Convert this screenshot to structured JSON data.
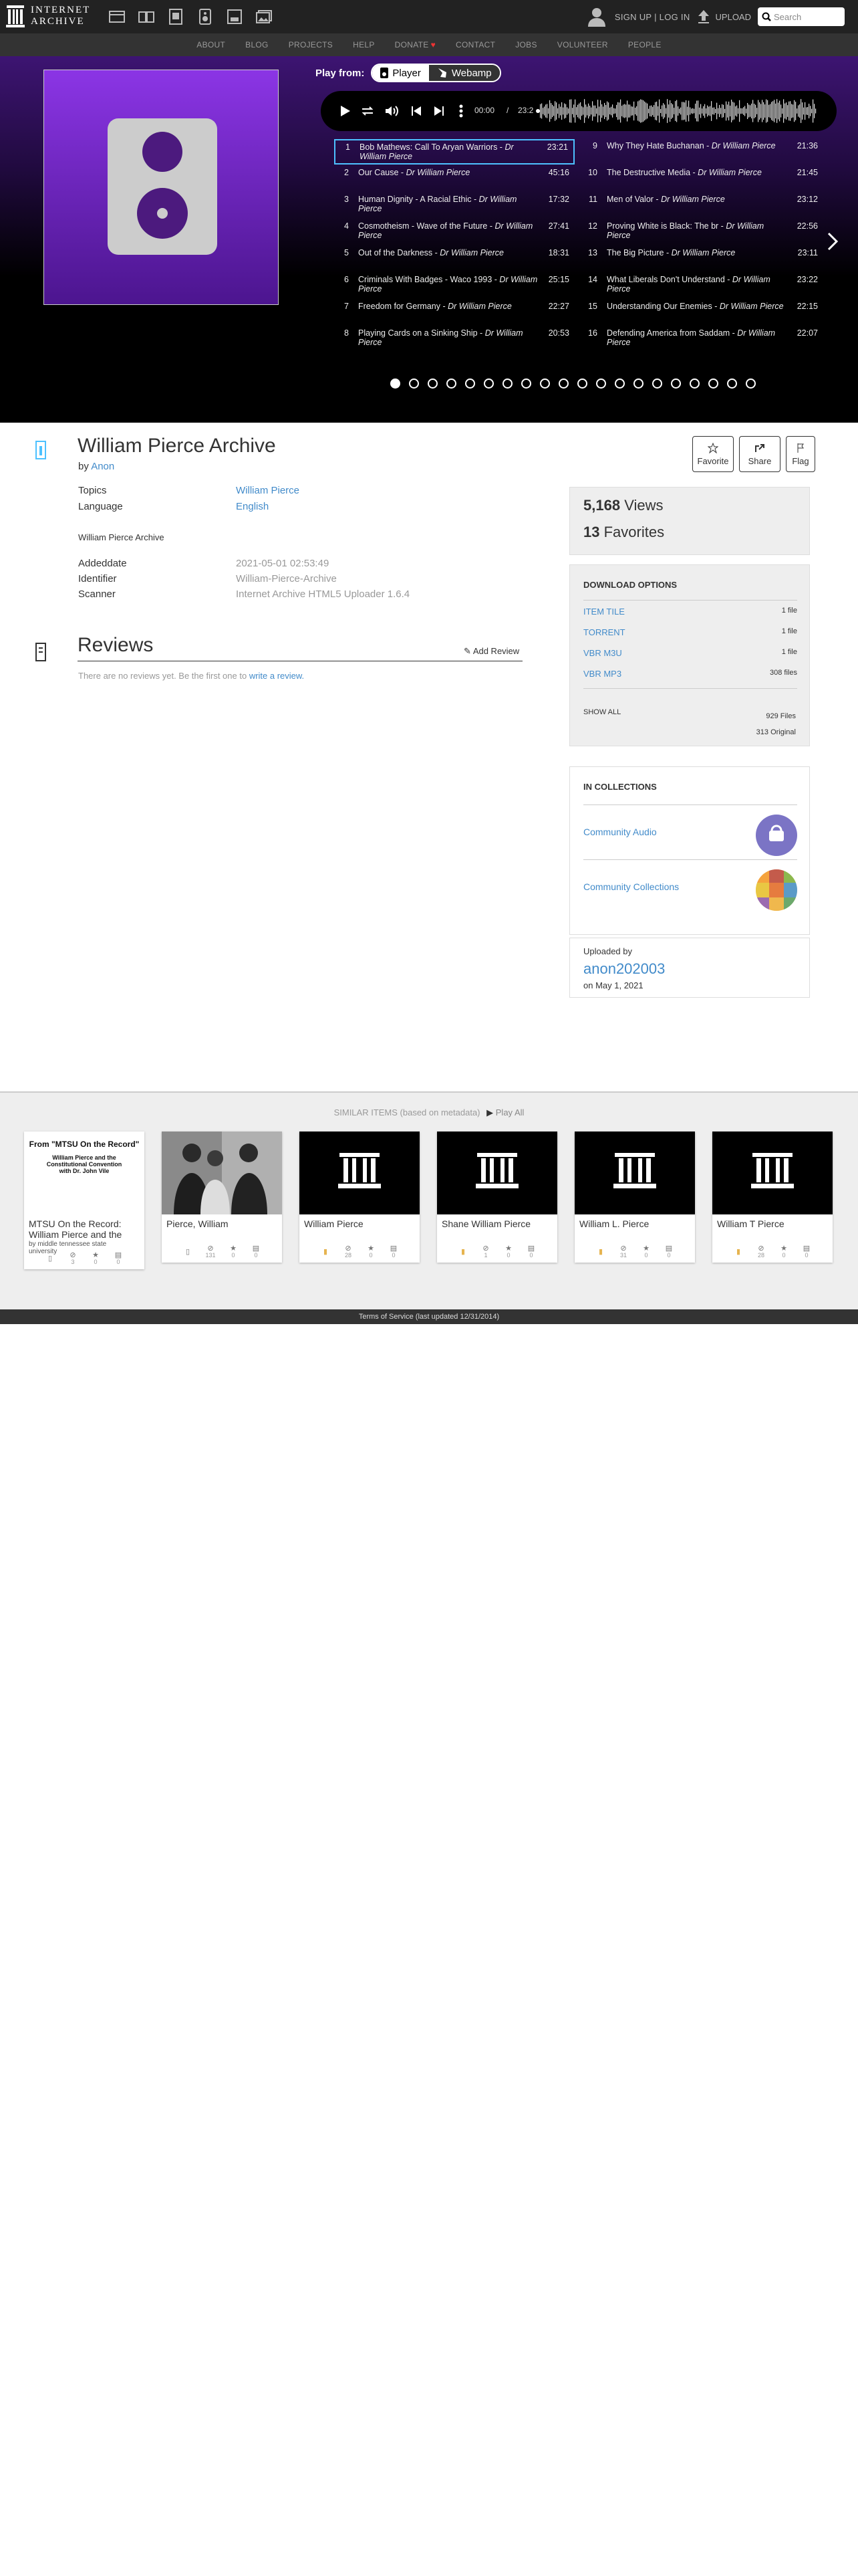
{
  "header": {
    "logo_text_1": "INTERNET",
    "logo_text_2": "ARCHIVE",
    "media_icons": [
      "web-icon",
      "texts-icon",
      "video-icon",
      "audio-icon",
      "software-icon",
      "images-icon"
    ],
    "signup": "SIGN UP | LOG IN",
    "upload": "UPLOAD",
    "search_placeholder": "Search"
  },
  "subnav": [
    "ABOUT",
    "BLOG",
    "PROJECTS",
    "HELP",
    "DONATE",
    "CONTACT",
    "JOBS",
    "VOLUNTEER",
    "PEOPLE"
  ],
  "player": {
    "play_from": "Play from:",
    "mode_player": "Player",
    "mode_webamp": "Webamp",
    "current_time": "00:00",
    "separator": "/",
    "total_time": "23:2"
  },
  "tracks": [
    {
      "num": "1",
      "title": "Bob Mathews: Call To Aryan Warriors",
      "artist": "Dr William Pierce",
      "dur": "23:21"
    },
    {
      "num": "2",
      "title": "Our Cause",
      "artist": "Dr William Pierce",
      "dur": "45:16"
    },
    {
      "num": "3",
      "title": "Human Dignity - A Racial Ethic",
      "artist": "Dr William Pierce",
      "dur": "17:32"
    },
    {
      "num": "4",
      "title": "Cosmotheism - Wave of the Future",
      "artist": "Dr William Pierce",
      "dur": "27:41"
    },
    {
      "num": "5",
      "title": "Out of the Darkness",
      "artist": "Dr William Pierce",
      "dur": "18:31"
    },
    {
      "num": "6",
      "title": "Criminals With Badges - Waco 1993",
      "artist": "Dr William Pierce",
      "dur": "25:15"
    },
    {
      "num": "7",
      "title": "Freedom for Germany",
      "artist": "Dr William Pierce",
      "dur": "22:27"
    },
    {
      "num": "8",
      "title": "Playing Cards on a Sinking Ship",
      "artist": "Dr William Pierce",
      "dur": "20:53"
    },
    {
      "num": "9",
      "title": "Why They Hate Buchanan",
      "artist": "Dr William Pierce",
      "dur": "21:36"
    },
    {
      "num": "10",
      "title": "The Destructive Media",
      "artist": "Dr William Pierce",
      "dur": "21:45"
    },
    {
      "num": "11",
      "title": "Men of Valor",
      "artist": "Dr William Pierce",
      "dur": "23:12"
    },
    {
      "num": "12",
      "title": "Proving White is Black: The br",
      "artist": "Dr William Pierce",
      "dur": "22:56"
    },
    {
      "num": "13",
      "title": "The Big Picture",
      "artist": "Dr William Pierce",
      "dur": "23:11"
    },
    {
      "num": "14",
      "title": "What Liberals Don't Understand",
      "artist": "Dr William Pierce",
      "dur": "23:22"
    },
    {
      "num": "15",
      "title": "Understanding Our Enemies",
      "artist": "Dr William Pierce",
      "dur": "22:15"
    },
    {
      "num": "16",
      "title": "Defending America from Saddam",
      "artist": "Dr William Pierce",
      "dur": "22:07"
    }
  ],
  "item": {
    "title": "William Pierce Archive",
    "by_label": "by",
    "by": "Anon",
    "meta": [
      {
        "k": "Topics",
        "v": "William Pierce",
        "link": true
      },
      {
        "k": "Language",
        "v": "English",
        "link": true
      }
    ],
    "description": "William Pierce Archive",
    "meta2": [
      {
        "k": "Addeddate",
        "v": "2021-05-01 02:53:49"
      },
      {
        "k": "Identifier",
        "v": "William-Pierce-Archive"
      },
      {
        "k": "Scanner",
        "v": "Internet Archive HTML5 Uploader 1.6.4"
      }
    ],
    "favorite_label": "Favorite",
    "share_label": "Share",
    "flag_label": "Flag"
  },
  "reviews": {
    "heading": "Reviews",
    "add_review": "Add Review",
    "empty_text": "There are no reviews yet. Be the first one to",
    "empty_link": "write a review."
  },
  "stats": {
    "views_num": "5,168",
    "views_label": "Views",
    "favs_num": "13",
    "favs_label": "Favorites"
  },
  "downloads": {
    "heading": "DOWNLOAD OPTIONS",
    "rows": [
      {
        "name": "ITEM TILE",
        "count": "1 file"
      },
      {
        "name": "TORRENT",
        "count": "1 file"
      },
      {
        "name": "VBR M3U",
        "count": "1 file"
      },
      {
        "name": "VBR MP3",
        "count": "308 files"
      }
    ],
    "show_all": "SHOW ALL",
    "files_total": "929 Files",
    "files_original": "313 Original"
  },
  "collections": {
    "heading": "IN COLLECTIONS",
    "items": [
      "Community Audio",
      "Community Collections"
    ]
  },
  "uploader": {
    "label": "Uploaded by",
    "name": "anon202003",
    "date": "on May 1, 2021"
  },
  "similar": {
    "heading": "SIMILAR ITEMS (based on metadata)",
    "play_all": "Play All",
    "tiles": [
      {
        "title": "MTSU On the Record: William Pierce and the",
        "by": "by middle tennessee state university",
        "img_title": "From \"MTSU On the Record\"",
        "img_sub1": "William Pierce and the",
        "img_sub2": "Constitutional Convention",
        "img_sub3": "with Dr. John Vile",
        "stats": [
          "3",
          "0",
          "0"
        ],
        "kind": "texts"
      },
      {
        "title": "Pierce, William",
        "by": "",
        "stats": [
          "131",
          "0",
          "0"
        ],
        "kind": "photo"
      },
      {
        "title": "William Pierce",
        "by": "",
        "stats": [
          "28",
          "0",
          "0"
        ],
        "kind": "archive"
      },
      {
        "title": "Shane William Pierce",
        "by": "",
        "stats": [
          "1",
          "0",
          "0"
        ],
        "kind": "archive"
      },
      {
        "title": "William L. Pierce",
        "by": "",
        "stats": [
          "31",
          "0",
          "0"
        ],
        "kind": "archive"
      },
      {
        "title": "William T Pierce",
        "by": "",
        "stats": [
          "28",
          "0",
          "0"
        ],
        "kind": "archive"
      }
    ]
  },
  "footer": "Terms of Service (last updated 12/31/2014)"
}
